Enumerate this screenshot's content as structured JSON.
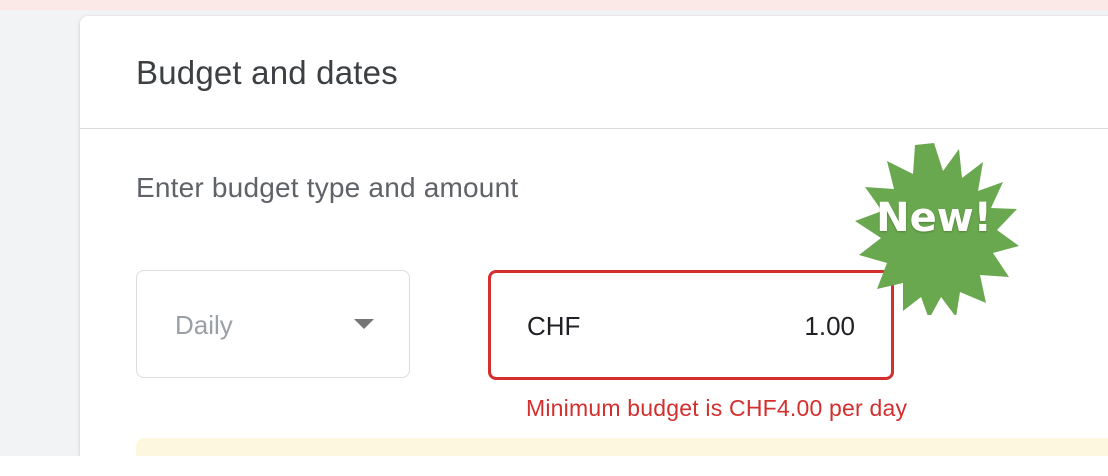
{
  "card": {
    "title": "Budget and dates",
    "subtitle": "Enter budget type and amount"
  },
  "budget": {
    "type_selected": "Daily",
    "currency": "CHF",
    "amount": "1.00",
    "error": "Minimum budget is CHF4.00 per day"
  },
  "badge": {
    "text": "New!",
    "color": "#6aa84f"
  },
  "colors": {
    "error": "#d32f2f",
    "notice": "#fef7e0"
  }
}
